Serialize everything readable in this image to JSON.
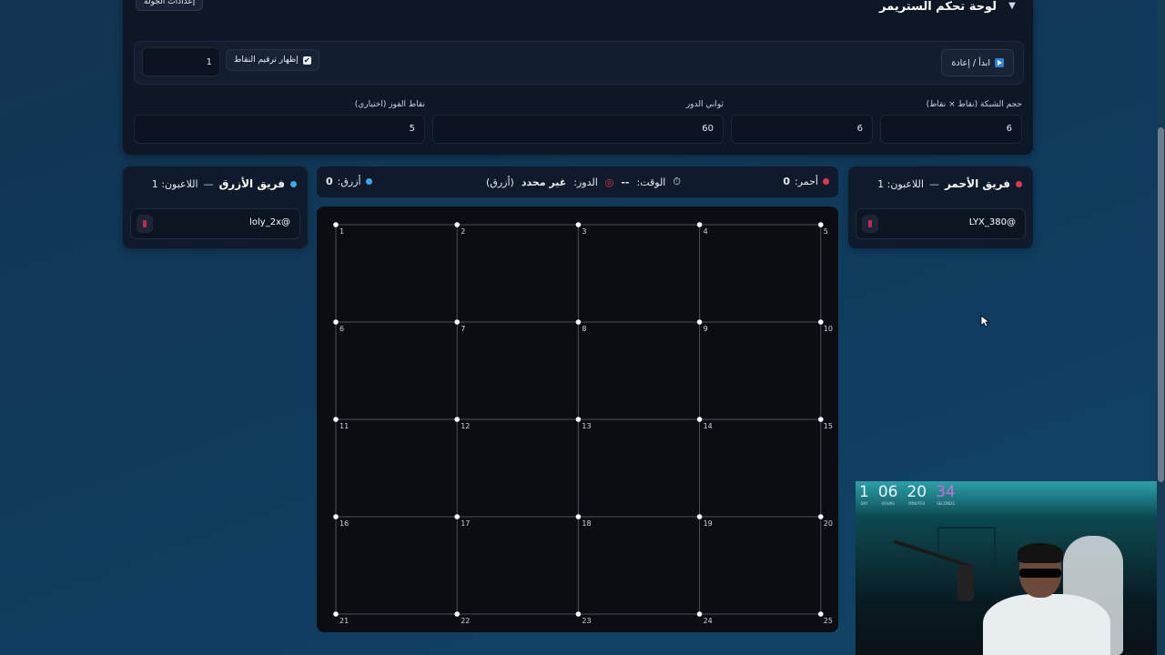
{
  "control_panel": {
    "title": "لوحة تحكم الستريمر",
    "round_settings": "إعدادات الجولة",
    "start_reset": "ابدأ / إعادة",
    "show_numbering": "إظهار ترقيم النقاط",
    "numbering_value": "1",
    "fields": {
      "grid_size_label": "حجم الشبكة (نقاط × نقاط)",
      "grid_cols": "6",
      "grid_rows": "6",
      "turn_seconds_label": "ثواني الدور",
      "turn_seconds": "60",
      "win_points_label": "نقاط الفوز (اختياري)",
      "win_points": "5"
    }
  },
  "red_team": {
    "name": "فريق الأحمر",
    "dash": "—",
    "players_label": "اللاعبون: 1",
    "player": "LYX_380@"
  },
  "blue_team": {
    "name": "فريق الأزرق",
    "dash": "—",
    "players_label": "اللاعبون: 1",
    "player": "loly_2x@"
  },
  "score_bar": {
    "red_label": "أحمر:",
    "red_score": "0",
    "blue_label": "أزرق:",
    "blue_score": "0",
    "time_label": "الوقت:",
    "time_value": "--",
    "turn_label": "الدور:",
    "turn_value": "غير محدد",
    "turn_team": "(أزرق)"
  },
  "board": {
    "rows": 5,
    "cols": 5,
    "point_labels": [
      "1",
      "2",
      "3",
      "4",
      "5",
      "6",
      "7",
      "8",
      "9",
      "10",
      "11",
      "12",
      "13",
      "14",
      "15",
      "16",
      "17",
      "18",
      "19",
      "20",
      "21",
      "22",
      "23",
      "24",
      "25"
    ]
  },
  "webcam": {
    "countdown": [
      {
        "value": "1",
        "unit": "DAY"
      },
      {
        "value": "06",
        "unit": "HOURS"
      },
      {
        "value": "20",
        "unit": "MINUTES"
      },
      {
        "value": "34",
        "unit": "SECONDS"
      }
    ]
  },
  "colors": {
    "red": "#e0364f",
    "blue": "#38a9e8",
    "board_bg": "#0b0d12",
    "grid_line": "#4a4f5c"
  }
}
